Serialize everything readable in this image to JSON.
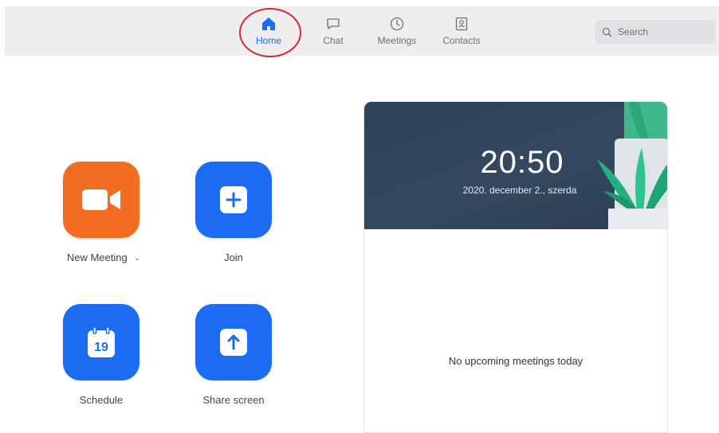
{
  "nav": {
    "items": [
      {
        "label": "Home",
        "icon": "home-icon",
        "active": true
      },
      {
        "label": "Chat",
        "icon": "chat-icon",
        "active": false
      },
      {
        "label": "Meetings",
        "icon": "clock-icon",
        "active": false
      },
      {
        "label": "Contacts",
        "icon": "contacts-icon",
        "active": false
      }
    ],
    "active_color": "#1b6cf2",
    "highlight_color": "#e0242a"
  },
  "search": {
    "placeholder": "Search",
    "icon": "search-icon"
  },
  "actions": [
    {
      "label": "New Meeting",
      "icon": "video-camera-icon",
      "color": "#f26d21",
      "has_dropdown": true
    },
    {
      "label": "Join",
      "icon": "plus-icon",
      "color": "#1b6cf2"
    },
    {
      "label": "Schedule",
      "icon": "calendar-icon",
      "color": "#1b6cf2",
      "calendar_day": "19"
    },
    {
      "label": "Share screen",
      "icon": "share-arrow-icon",
      "color": "#1b6cf2"
    }
  ],
  "panel": {
    "time": "20:50",
    "date": "2020. december 2., szerda",
    "empty_message": "No upcoming meetings today",
    "banner_color": "#34495f"
  }
}
